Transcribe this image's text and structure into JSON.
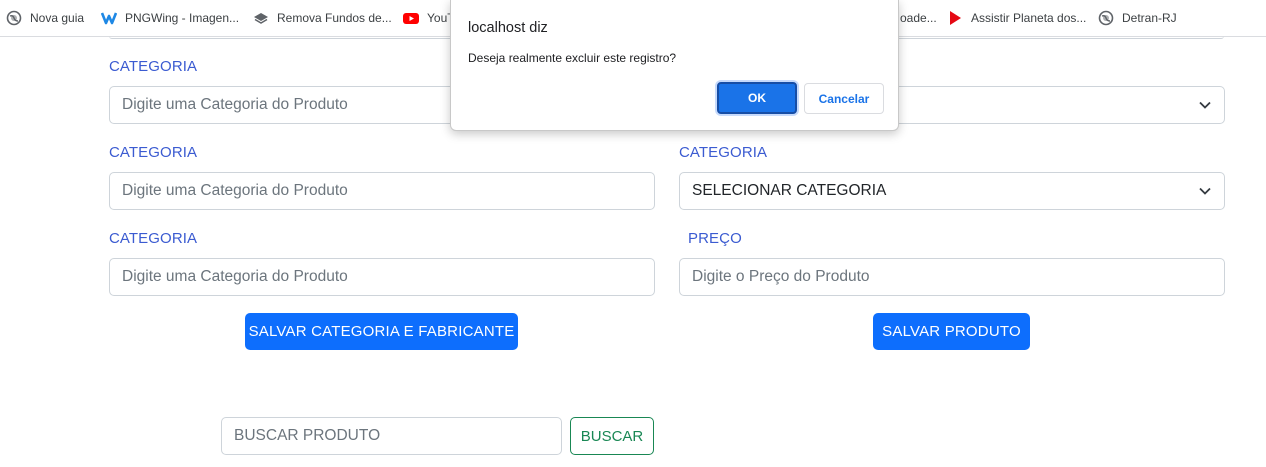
{
  "bookmarks": [
    {
      "label": "Nova guia",
      "icon": "globe-icon"
    },
    {
      "label": "PNGWing - Imagen...",
      "icon": "pngwing-logo-icon"
    },
    {
      "label": "Remova Fundos de...",
      "icon": "layers-icon"
    },
    {
      "label": "YouT",
      "icon": "youtube-icon"
    },
    {
      "label": "oade...",
      "icon": ""
    },
    {
      "label": "Assistir Planeta dos...",
      "icon": "play-icon"
    },
    {
      "label": "Detran-RJ",
      "icon": "globe-icon"
    }
  ],
  "form": {
    "row1": {
      "left_label": "CATEGORIA",
      "left_placeholder": "Digite uma Categoria do Produto"
    },
    "row2": {
      "left_label": "CATEGORIA",
      "left_placeholder": "Digite uma Categoria do Produto",
      "right_label": "CATEGORIA",
      "right_value": "SELECIONAR CATEGORIA"
    },
    "row3": {
      "left_label": "CATEGORIA",
      "left_placeholder": "Digite uma Categoria do Produto",
      "right_label": "PREÇO",
      "right_placeholder": "Digite o Preço do Produto"
    },
    "save_category_label": "SALVAR CATEGORIA E FABRICANTE",
    "save_product_label": "SALVAR PRODUTO"
  },
  "search": {
    "placeholder": "BUSCAR PRODUTO",
    "button_label": "BUSCAR"
  },
  "dialog": {
    "title": "localhost diz",
    "message": "Deseja realmente excluir este registro?",
    "ok_label": "OK",
    "cancel_label": "Cancelar"
  },
  "colors": {
    "label": "#3b5bd1",
    "primary": "#0d6efd",
    "success": "#198754",
    "dialog_ok": "#1a73e8"
  }
}
